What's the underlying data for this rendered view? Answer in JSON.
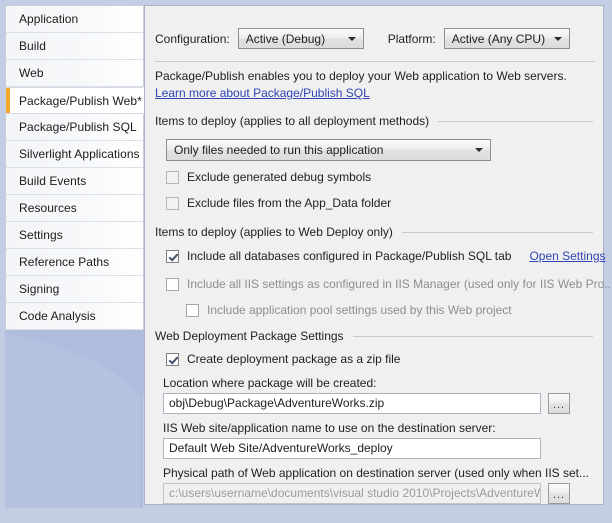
{
  "sidebar": {
    "items": [
      {
        "label": "Application",
        "selected": false
      },
      {
        "label": "Build",
        "selected": false
      },
      {
        "label": "Web",
        "selected": false
      },
      {
        "label": "Package/Publish Web*",
        "selected": true
      },
      {
        "label": "Package/Publish SQL",
        "selected": false
      },
      {
        "label": "Silverlight Applications",
        "selected": false
      },
      {
        "label": "Build Events",
        "selected": false
      },
      {
        "label": "Resources",
        "selected": false
      },
      {
        "label": "Settings",
        "selected": false
      },
      {
        "label": "Reference Paths",
        "selected": false
      },
      {
        "label": "Signing",
        "selected": false
      },
      {
        "label": "Code Analysis",
        "selected": false
      }
    ]
  },
  "toolbar": {
    "configuration_label": "Configuration:",
    "configuration_value": "Active (Debug)",
    "platform_label": "Platform:",
    "platform_value": "Active (Any CPU)"
  },
  "intro": {
    "description": "Package/Publish enables you to deploy your Web application to Web servers.",
    "link_text": "Learn more about Package/Publish SQL"
  },
  "sections": {
    "all_methods": "Items to deploy (applies to all deployment methods)",
    "web_deploy": "Items to deploy (applies to Web Deploy only)",
    "package_settings": "Web Deployment Package Settings"
  },
  "deploy_items": {
    "selected": "Only files needed to run this application",
    "exclude_debug_symbols": "Exclude generated debug symbols",
    "exclude_app_data": "Exclude files from the App_Data folder"
  },
  "web_deploy": {
    "include_databases": "Include all databases configured in Package/Publish SQL tab",
    "open_settings_link": "Open Settings",
    "include_iis_settings": "Include all IIS settings as configured in IIS Manager (used only for IIS Web Pro...",
    "include_app_pool": "Include application pool settings used by this Web project"
  },
  "package_settings": {
    "create_zip": "Create deployment package as a zip file",
    "location_label": "Location where package will be created:",
    "location_value": "obj\\Debug\\Package\\AdventureWorks.zip",
    "iis_name_label": "IIS Web site/application name to use on the destination server:",
    "iis_name_value": "Default Web Site/AdventureWorks_deploy",
    "physical_path_label": "Physical path of Web application on destination server (used only when IIS set...",
    "physical_path_value": "c:\\users\\username\\documents\\visual studio 2010\\Projects\\AdventureW...",
    "browse_label": "..."
  }
}
